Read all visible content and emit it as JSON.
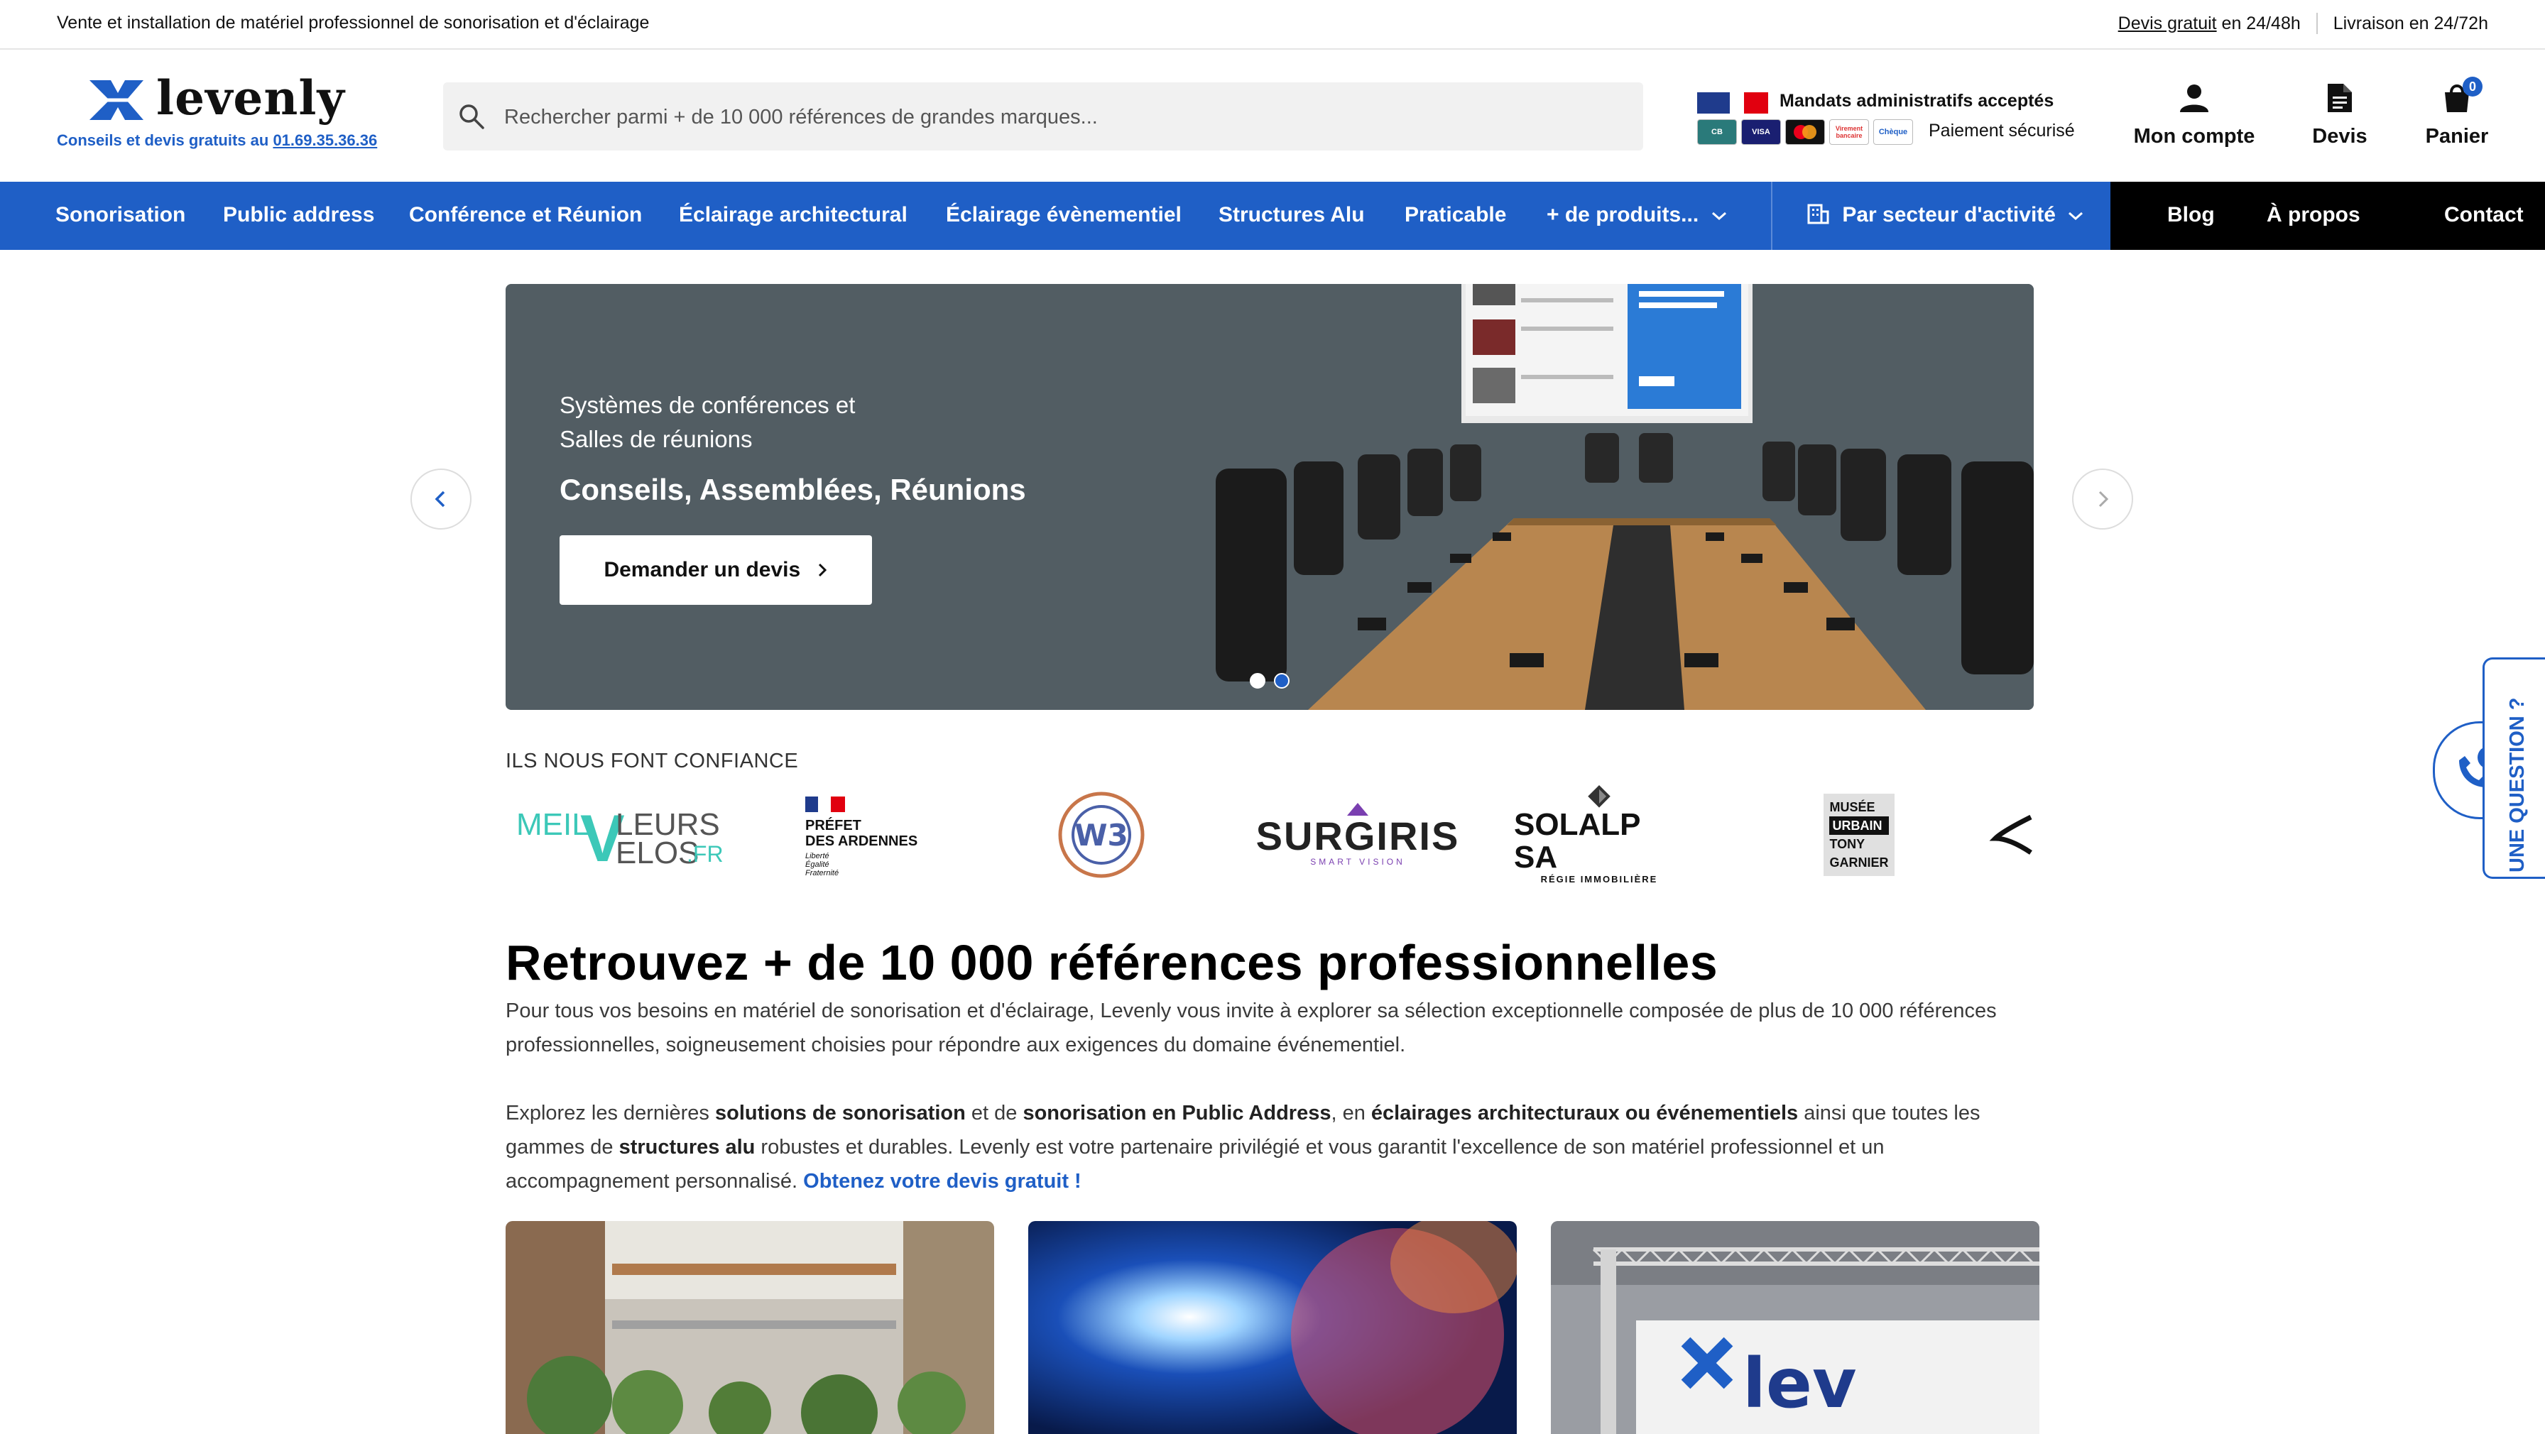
{
  "topbar": {
    "left_text": "Vente et installation de matériel professionnel de sonorisation et d'éclairage",
    "devis_link": "Devis gratuit",
    "devis_suffix": " en 24/48h",
    "livraison": "Livraison en 24/72h"
  },
  "header": {
    "logo_text": "levenly",
    "tagline_prefix": "Conseils et devis gratuits au ",
    "phone": "01.69.35.36.36",
    "search_placeholder": "Rechercher parmi + de 10 000 références de grandes marques...",
    "mandats": "Mandats administratifs acceptés",
    "paiement": "Paiement sécurisé",
    "payment_cards": [
      "CB",
      "VISA",
      "MC",
      "Virement bancaire",
      "Chèque"
    ],
    "account_label": "Mon compte",
    "devis_label": "Devis",
    "cart_label": "Panier",
    "cart_count": "0"
  },
  "nav": {
    "items": [
      "Sonorisation",
      "Public address",
      "Conférence et Réunion",
      "Éclairage architectural",
      "Éclairage évènementiel",
      "Structures Alu",
      "Praticable",
      "+ de produits..."
    ],
    "sector": "Par secteur d'activité",
    "right_items": [
      "Blog",
      "À propos",
      "Contact"
    ]
  },
  "hero": {
    "subtitle_line1": "Systèmes de conférences et",
    "subtitle_line2": "Salles de réunions",
    "title": "Conseils, Assemblées, Réunions",
    "button": "Demander un devis",
    "slide_count": 2,
    "active_slide": 1
  },
  "partners": {
    "title": "ILS NOUS FONT CONFIANCE",
    "logos": [
      {
        "l1": "MEIL",
        "v": "V",
        "l2": "LEURS",
        "l3": "ELOS",
        "fr": ".FR"
      },
      {
        "line1": "PRÉFET",
        "line2": "DES ARDENNES",
        "motto1": "Liberté",
        "motto2": "Égalité",
        "motto3": "Fraternité"
      },
      {
        "text": "W3"
      },
      {
        "name": "SURGIRIS",
        "tagline": "SMART VISION"
      },
      {
        "name": "SOLALP SA",
        "tagline": "RÉGIE IMMOBILIÈRE"
      },
      {
        "lines": [
          "MUSÉE",
          "URBAIN",
          "TONY",
          "GARNIER"
        ]
      }
    ]
  },
  "side_tab": {
    "label": "UNE QUESTION ?"
  },
  "main": {
    "title": "Retrouvez + de 10 000 références professionnelles",
    "p1": "Pour tous vos besoins en matériel de sonorisation et d'éclairage, Levenly vous invite à explorer sa sélection exceptionnelle composée de plus de 10 000 références professionnelles, soigneusement choisies pour répondre aux exigences du domaine événementiel.",
    "p2_a": "Explorez les dernières ",
    "p2_b": "solutions de sonorisation",
    "p2_c": " et de ",
    "p2_d": "sonorisation en Public Address",
    "p2_e": ", en ",
    "p2_f": "éclairages architecturaux ou événementiels",
    "p2_g": " ainsi que toutes les gammes de ",
    "p2_h": "structures alu",
    "p2_i": " robustes et durables. Levenly est votre partenaire privilégié et vous garantit l'excellence de son matériel professionnel et un accompagnement personnalisé. ",
    "p2_cta": "Obtenez votre devis gratuit !",
    "card_logo_text": "lev"
  },
  "colors": {
    "brand_blue": "#1f5fc6",
    "hero_bg": "#525d63"
  }
}
